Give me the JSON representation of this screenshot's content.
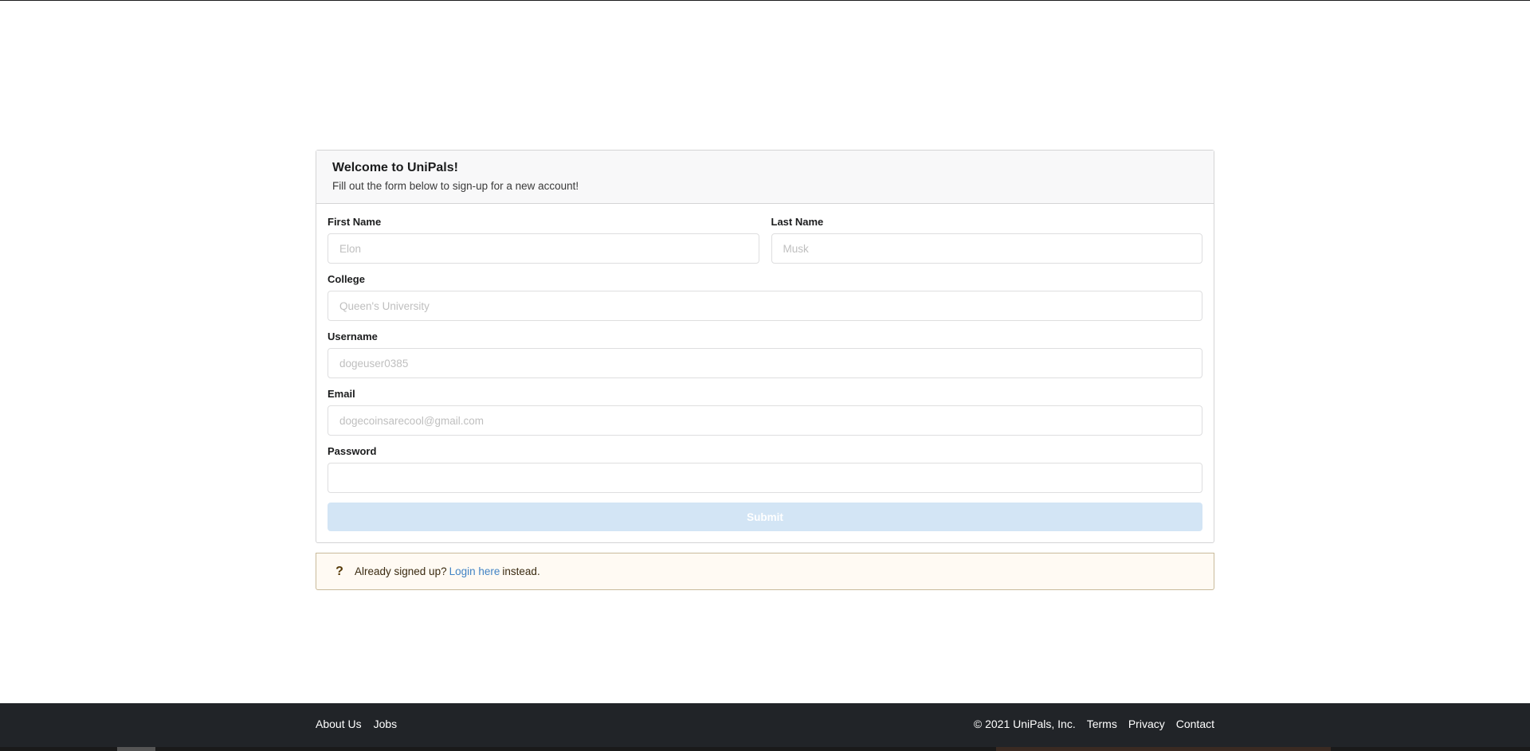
{
  "header": {
    "title": "Welcome to UniPals!",
    "subtitle": "Fill out the form below to sign-up for a new account!"
  },
  "form": {
    "first_name": {
      "label": "First Name",
      "placeholder": "Elon",
      "value": ""
    },
    "last_name": {
      "label": "Last Name",
      "placeholder": "Musk",
      "value": ""
    },
    "college": {
      "label": "College",
      "placeholder": "Queen's University",
      "value": ""
    },
    "username": {
      "label": "Username",
      "placeholder": "dogeuser0385",
      "value": ""
    },
    "email": {
      "label": "Email",
      "placeholder": "dogecoinsarecool@gmail.com",
      "value": ""
    },
    "password": {
      "label": "Password",
      "placeholder": "",
      "value": ""
    },
    "submit_label": "Submit"
  },
  "login_note": {
    "icon": "question-icon",
    "prefix": "Already signed up?",
    "link_label": "Login here",
    "suffix": "instead."
  },
  "footer": {
    "left_links": [
      "About Us",
      "Jobs"
    ],
    "copyright": "© 2021 UniPals, Inc.",
    "right_links": [
      "Terms",
      "Privacy",
      "Contact"
    ]
  },
  "colors": {
    "submit_disabled": "#d3e5f5",
    "link": "#4183c4",
    "note_background": "#fffaf3",
    "footer_background": "#212428"
  }
}
